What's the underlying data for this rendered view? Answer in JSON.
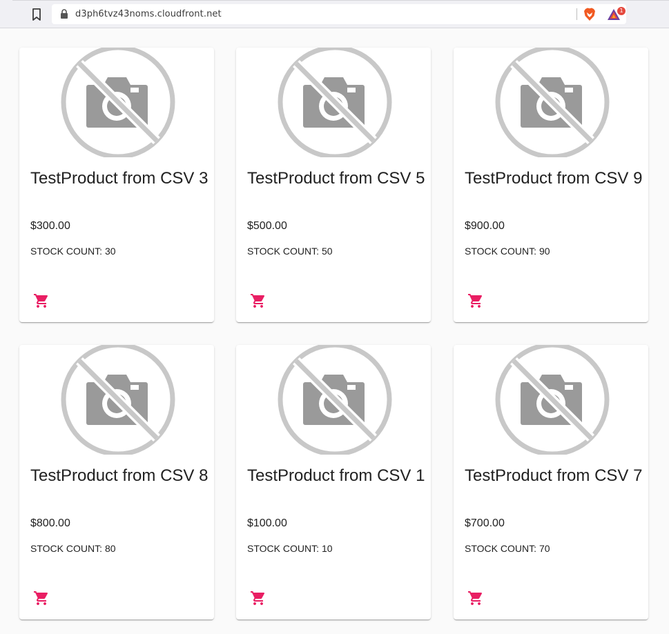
{
  "browser": {
    "url": "d3ph6tvz43noms.cloudfront.net",
    "rewards_badge": "1"
  },
  "colors": {
    "accent": "#e91e63",
    "placeholder_gray": "#c8c8c8",
    "camera_gray": "#9a9a9a"
  },
  "stock_label": "STOCK COUNT:",
  "products": [
    {
      "title": "TestProduct from CSV 3",
      "price": "$300.00",
      "stock": "30"
    },
    {
      "title": "TestProduct from CSV 5",
      "price": "$500.00",
      "stock": "50"
    },
    {
      "title": "TestProduct from CSV 9",
      "price": "$900.00",
      "stock": "90"
    },
    {
      "title": "TestProduct from CSV 8",
      "price": "$800.00",
      "stock": "80"
    },
    {
      "title": "TestProduct from CSV 1",
      "price": "$100.00",
      "stock": "10"
    },
    {
      "title": "TestProduct from CSV 7",
      "price": "$700.00",
      "stock": "70"
    }
  ]
}
